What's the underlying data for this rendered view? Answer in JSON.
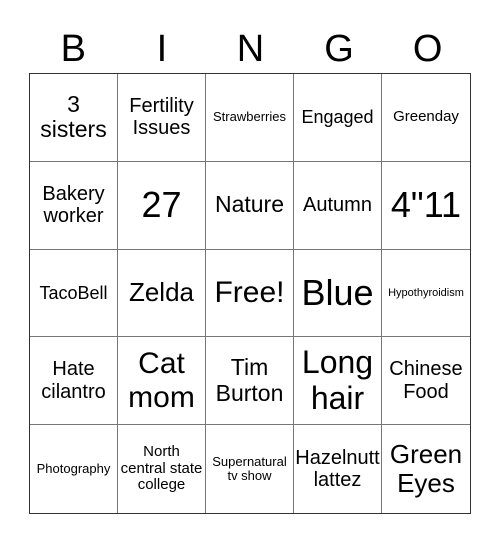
{
  "header": [
    "B",
    "I",
    "N",
    "G",
    "O"
  ],
  "cells": [
    {
      "text": "3 sisters",
      "size": "s23"
    },
    {
      "text": "Fertility Issues",
      "size": "s19"
    },
    {
      "text": "Strawberries",
      "size": "s12"
    },
    {
      "text": "Engaged",
      "size": "s17"
    },
    {
      "text": "Greenday",
      "size": "s14"
    },
    {
      "text": "Bakery worker",
      "size": "s19"
    },
    {
      "text": "27",
      "size": "s36"
    },
    {
      "text": "Nature",
      "size": "s23"
    },
    {
      "text": "Autumn",
      "size": "s19"
    },
    {
      "text": "4\"11",
      "size": "s36"
    },
    {
      "text": "TacoBell",
      "size": "s17"
    },
    {
      "text": "Zelda",
      "size": "s26"
    },
    {
      "text": "Free!",
      "size": "s29"
    },
    {
      "text": "Blue",
      "size": "s36"
    },
    {
      "text": "Hypothyroidism",
      "size": "s11"
    },
    {
      "text": "Hate cilantro",
      "size": "s19"
    },
    {
      "text": "Cat mom",
      "size": "s29"
    },
    {
      "text": "Tim Burton",
      "size": "s23"
    },
    {
      "text": "Long hair",
      "size": "s32"
    },
    {
      "text": "Chinese Food",
      "size": "s19"
    },
    {
      "text": "Photography",
      "size": "s12"
    },
    {
      "text": "North central state college",
      "size": "s14"
    },
    {
      "text": "Supernatural tv show",
      "size": "s12"
    },
    {
      "text": "Hazelnutt lattez",
      "size": "s19"
    },
    {
      "text": "Green Eyes",
      "size": "s26"
    }
  ]
}
